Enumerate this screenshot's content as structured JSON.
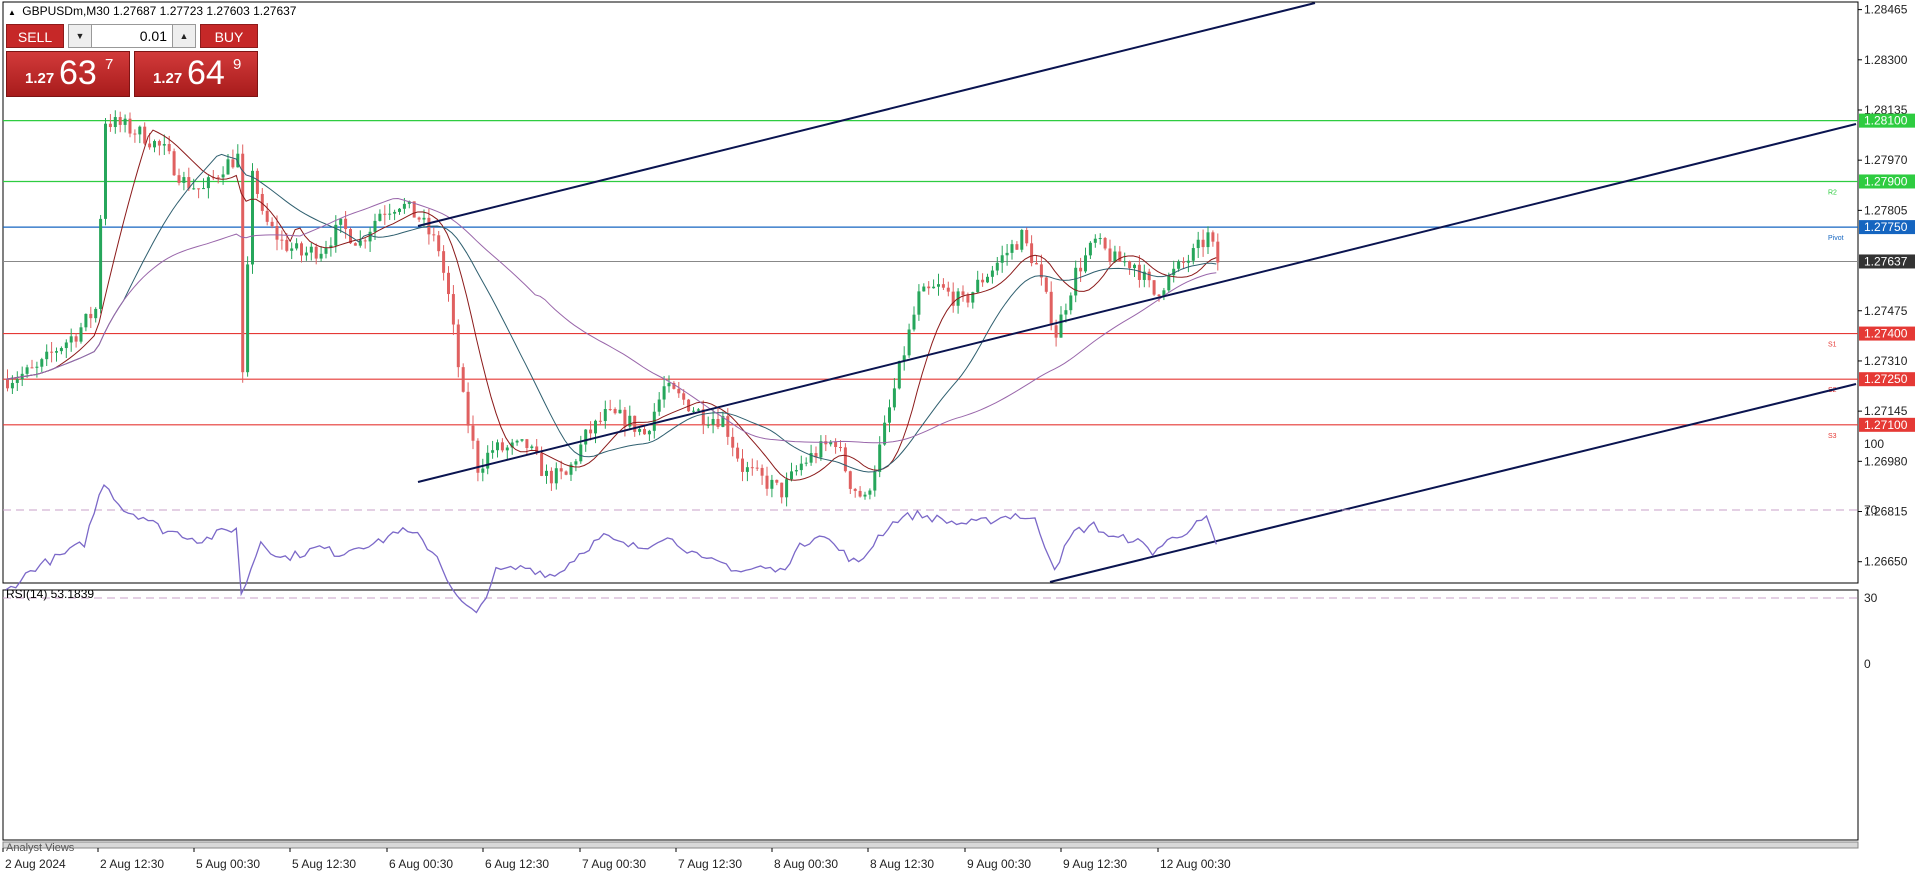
{
  "header": {
    "symbol_info": "GBPUSDm,M30",
    "ohlc": "1.27687 1.27723 1.27603 1.27637"
  },
  "trade_panel": {
    "sell_label": "SELL",
    "buy_label": "BUY",
    "lot_value": "0.01",
    "sell_price_prefix": "1.27",
    "sell_price_main": "63",
    "sell_price_sup": "7",
    "buy_price_prefix": "1.27",
    "buy_price_main": "64",
    "buy_price_sup": "9"
  },
  "price_axis": {
    "ticks": [
      "1.28465",
      "1.28300",
      "1.28135",
      "1.27970",
      "1.27805",
      "1.27475",
      "1.27310",
      "1.27145",
      "1.26980",
      "1.26815",
      "1.26650"
    ],
    "tick_values": [
      1.28465,
      1.283,
      1.28135,
      1.2797,
      1.27805,
      1.27475,
      1.2731,
      1.27145,
      1.2698,
      1.26815,
      1.2665
    ],
    "range": [
      1.2658,
      1.2849
    ]
  },
  "levels": [
    {
      "value": 1.281,
      "label": "1.28100",
      "color": "#2ecc40",
      "tag": ""
    },
    {
      "value": 1.279,
      "label": "1.27900",
      "color": "#2ecc40",
      "tag": "R2"
    },
    {
      "value": 1.2775,
      "label": "1.27750",
      "color": "#1565c0",
      "tag": "Pivot"
    },
    {
      "value": 1.274,
      "label": "1.27400",
      "color": "#e53935",
      "tag": "S1"
    },
    {
      "value": 1.2725,
      "label": "1.27250",
      "color": "#e53935",
      "tag": "S2"
    },
    {
      "value": 1.271,
      "label": "1.27100",
      "color": "#e53935",
      "tag": "S3"
    }
  ],
  "current_price": {
    "value": 1.27637,
    "label": "1.27637",
    "color": "#333333"
  },
  "rsi": {
    "title": "RSI(14) 53.1839",
    "ticks": [
      "100",
      "70",
      "30",
      "0"
    ],
    "tick_values": [
      100,
      70,
      30,
      0
    ],
    "overbought": 70,
    "oversold": 30,
    "line_color": "#7b68c8"
  },
  "time_axis": {
    "labels": [
      "2 Aug 2024",
      "2 Aug 12:30",
      "5 Aug 00:30",
      "5 Aug 12:30",
      "6 Aug 00:30",
      "6 Aug 12:30",
      "7 Aug 00:30",
      "7 Aug 12:30",
      "8 Aug 00:30",
      "8 Aug 12:30",
      "9 Aug 00:30",
      "9 Aug 12:30",
      "12 Aug 00:30"
    ]
  },
  "bottom_tab": "Analyst Views",
  "colors": {
    "bull": "#26a65b",
    "bear": "#e06060",
    "ma_fast": "#8b1a1a",
    "ma_mid": "#2f5f6f",
    "ma_slow": "#9966aa",
    "channel": "#0a1450"
  },
  "chart_data": {
    "type": "candlestick",
    "bar_count": 248,
    "close_path": [
      [
        0,
        1.2725
      ],
      [
        6,
        1.2728
      ],
      [
        10,
        1.2735
      ],
      [
        14,
        1.274
      ],
      [
        18,
        1.2748
      ],
      [
        20,
        1.281
      ],
      [
        24,
        1.2808
      ],
      [
        28,
        1.2805
      ],
      [
        32,
        1.28
      ],
      [
        36,
        1.279
      ],
      [
        40,
        1.2787
      ],
      [
        44,
        1.2795
      ],
      [
        47,
        1.2798
      ],
      [
        48,
        1.2725
      ],
      [
        50,
        1.2795
      ],
      [
        52,
        1.2778
      ],
      [
        56,
        1.277
      ],
      [
        60,
        1.2766
      ],
      [
        64,
        1.2768
      ],
      [
        68,
        1.2775
      ],
      [
        72,
        1.277
      ],
      [
        76,
        1.278
      ],
      [
        80,
        1.2783
      ],
      [
        84,
        1.2778
      ],
      [
        88,
        1.2768
      ],
      [
        90,
        1.2752
      ],
      [
        93,
        1.2718
      ],
      [
        96,
        1.2696
      ],
      [
        99,
        1.2702
      ],
      [
        102,
        1.2702
      ],
      [
        106,
        1.2703
      ],
      [
        110,
        1.2693
      ],
      [
        114,
        1.2693
      ],
      [
        118,
        1.2706
      ],
      [
        122,
        1.2713
      ],
      [
        126,
        1.2712
      ],
      [
        130,
        1.2707
      ],
      [
        134,
        1.2722
      ],
      [
        138,
        1.2718
      ],
      [
        142,
        1.2713
      ],
      [
        146,
        1.2712
      ],
      [
        150,
        1.2696
      ],
      [
        154,
        1.2692
      ],
      [
        158,
        1.2688
      ],
      [
        162,
        1.2697
      ],
      [
        166,
        1.2702
      ],
      [
        169,
        1.2705
      ],
      [
        172,
        1.2691
      ],
      [
        175,
        1.2685
      ],
      [
        178,
        1.2702
      ],
      [
        182,
        1.2728
      ],
      [
        186,
        1.2752
      ],
      [
        190,
        1.2755
      ],
      [
        195,
        1.275
      ],
      [
        199,
        1.2758
      ],
      [
        203,
        1.2765
      ],
      [
        207,
        1.2772
      ],
      [
        210,
        1.2762
      ],
      [
        214,
        1.274
      ],
      [
        218,
        1.276
      ],
      [
        222,
        1.277
      ],
      [
        226,
        1.2764
      ],
      [
        230,
        1.2763
      ],
      [
        234,
        1.2753
      ],
      [
        238,
        1.276
      ],
      [
        242,
        1.2766
      ],
      [
        245,
        1.2772
      ],
      [
        247,
        1.27637
      ]
    ],
    "rsi_path": [
      [
        0,
        33
      ],
      [
        6,
        44
      ],
      [
        12,
        50
      ],
      [
        16,
        55
      ],
      [
        20,
        83
      ],
      [
        24,
        70
      ],
      [
        28,
        67
      ],
      [
        32,
        61
      ],
      [
        36,
        59
      ],
      [
        40,
        56
      ],
      [
        44,
        60
      ],
      [
        47,
        62
      ],
      [
        48,
        31
      ],
      [
        52,
        56
      ],
      [
        56,
        48
      ],
      [
        60,
        50
      ],
      [
        64,
        53
      ],
      [
        68,
        50
      ],
      [
        72,
        54
      ],
      [
        76,
        55
      ],
      [
        80,
        61
      ],
      [
        84,
        58
      ],
      [
        88,
        49
      ],
      [
        92,
        30
      ],
      [
        96,
        22
      ],
      [
        100,
        42
      ],
      [
        106,
        44
      ],
      [
        112,
        40
      ],
      [
        118,
        52
      ],
      [
        122,
        58
      ],
      [
        126,
        54
      ],
      [
        130,
        53
      ],
      [
        134,
        58
      ],
      [
        138,
        54
      ],
      [
        142,
        47
      ],
      [
        146,
        46
      ],
      [
        150,
        42
      ],
      [
        154,
        44
      ],
      [
        158,
        42
      ],
      [
        162,
        53
      ],
      [
        166,
        60
      ],
      [
        170,
        52
      ],
      [
        174,
        45
      ],
      [
        178,
        58
      ],
      [
        182,
        66
      ],
      [
        186,
        68
      ],
      [
        190,
        66
      ],
      [
        194,
        64
      ],
      [
        198,
        64
      ],
      [
        202,
        66
      ],
      [
        206,
        68
      ],
      [
        210,
        65
      ],
      [
        214,
        44
      ],
      [
        218,
        60
      ],
      [
        222,
        63
      ],
      [
        226,
        57
      ],
      [
        230,
        57
      ],
      [
        234,
        51
      ],
      [
        238,
        57
      ],
      [
        242,
        62
      ],
      [
        245,
        66
      ],
      [
        247,
        53
      ]
    ]
  }
}
